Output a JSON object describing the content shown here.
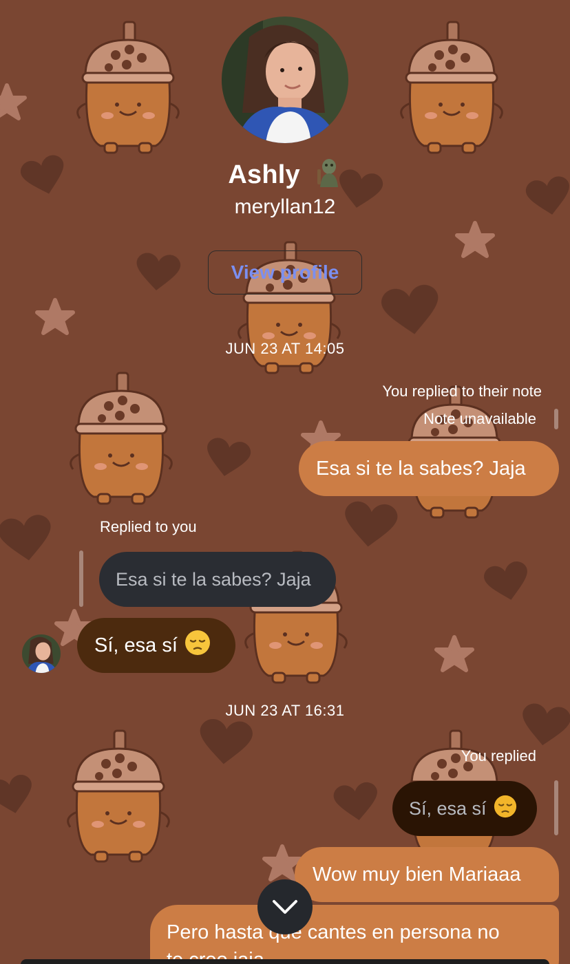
{
  "profile": {
    "name": "Ashly",
    "name_emoji": "troll-emoji",
    "username": "meryllan12",
    "view_profile_label": "View profile"
  },
  "thread": {
    "timestamp_1": "JUN 23 AT 14:05",
    "meta_replied_note": "You replied to their note",
    "meta_note_unavailable": "Note unavailable",
    "msg_out_1": "Esa si te la sabes? Jaja",
    "meta_replied_to_you": "Replied to you",
    "quote_1": "Esa si te la sabes? Jaja",
    "msg_in_1": "Sí, esa sí",
    "timestamp_2": "JUN 23 AT 16:31",
    "meta_you_replied": "You replied",
    "quote_2": "Sí, esa sí",
    "msg_out_2": "Wow muy bien Mariaaa",
    "msg_out_3_line1": "Pero hasta que cantes en persona no",
    "msg_out_3_line2": "te creo jaja"
  },
  "colors": {
    "background": "#7a4632",
    "outgoing_bubble": "#cc7d45",
    "incoming_bubble": "#4c2a0e",
    "link": "#7b8ff0"
  },
  "icons": {
    "pensive": "pensive-face-emoji",
    "scroll": "chevron-down-icon"
  }
}
